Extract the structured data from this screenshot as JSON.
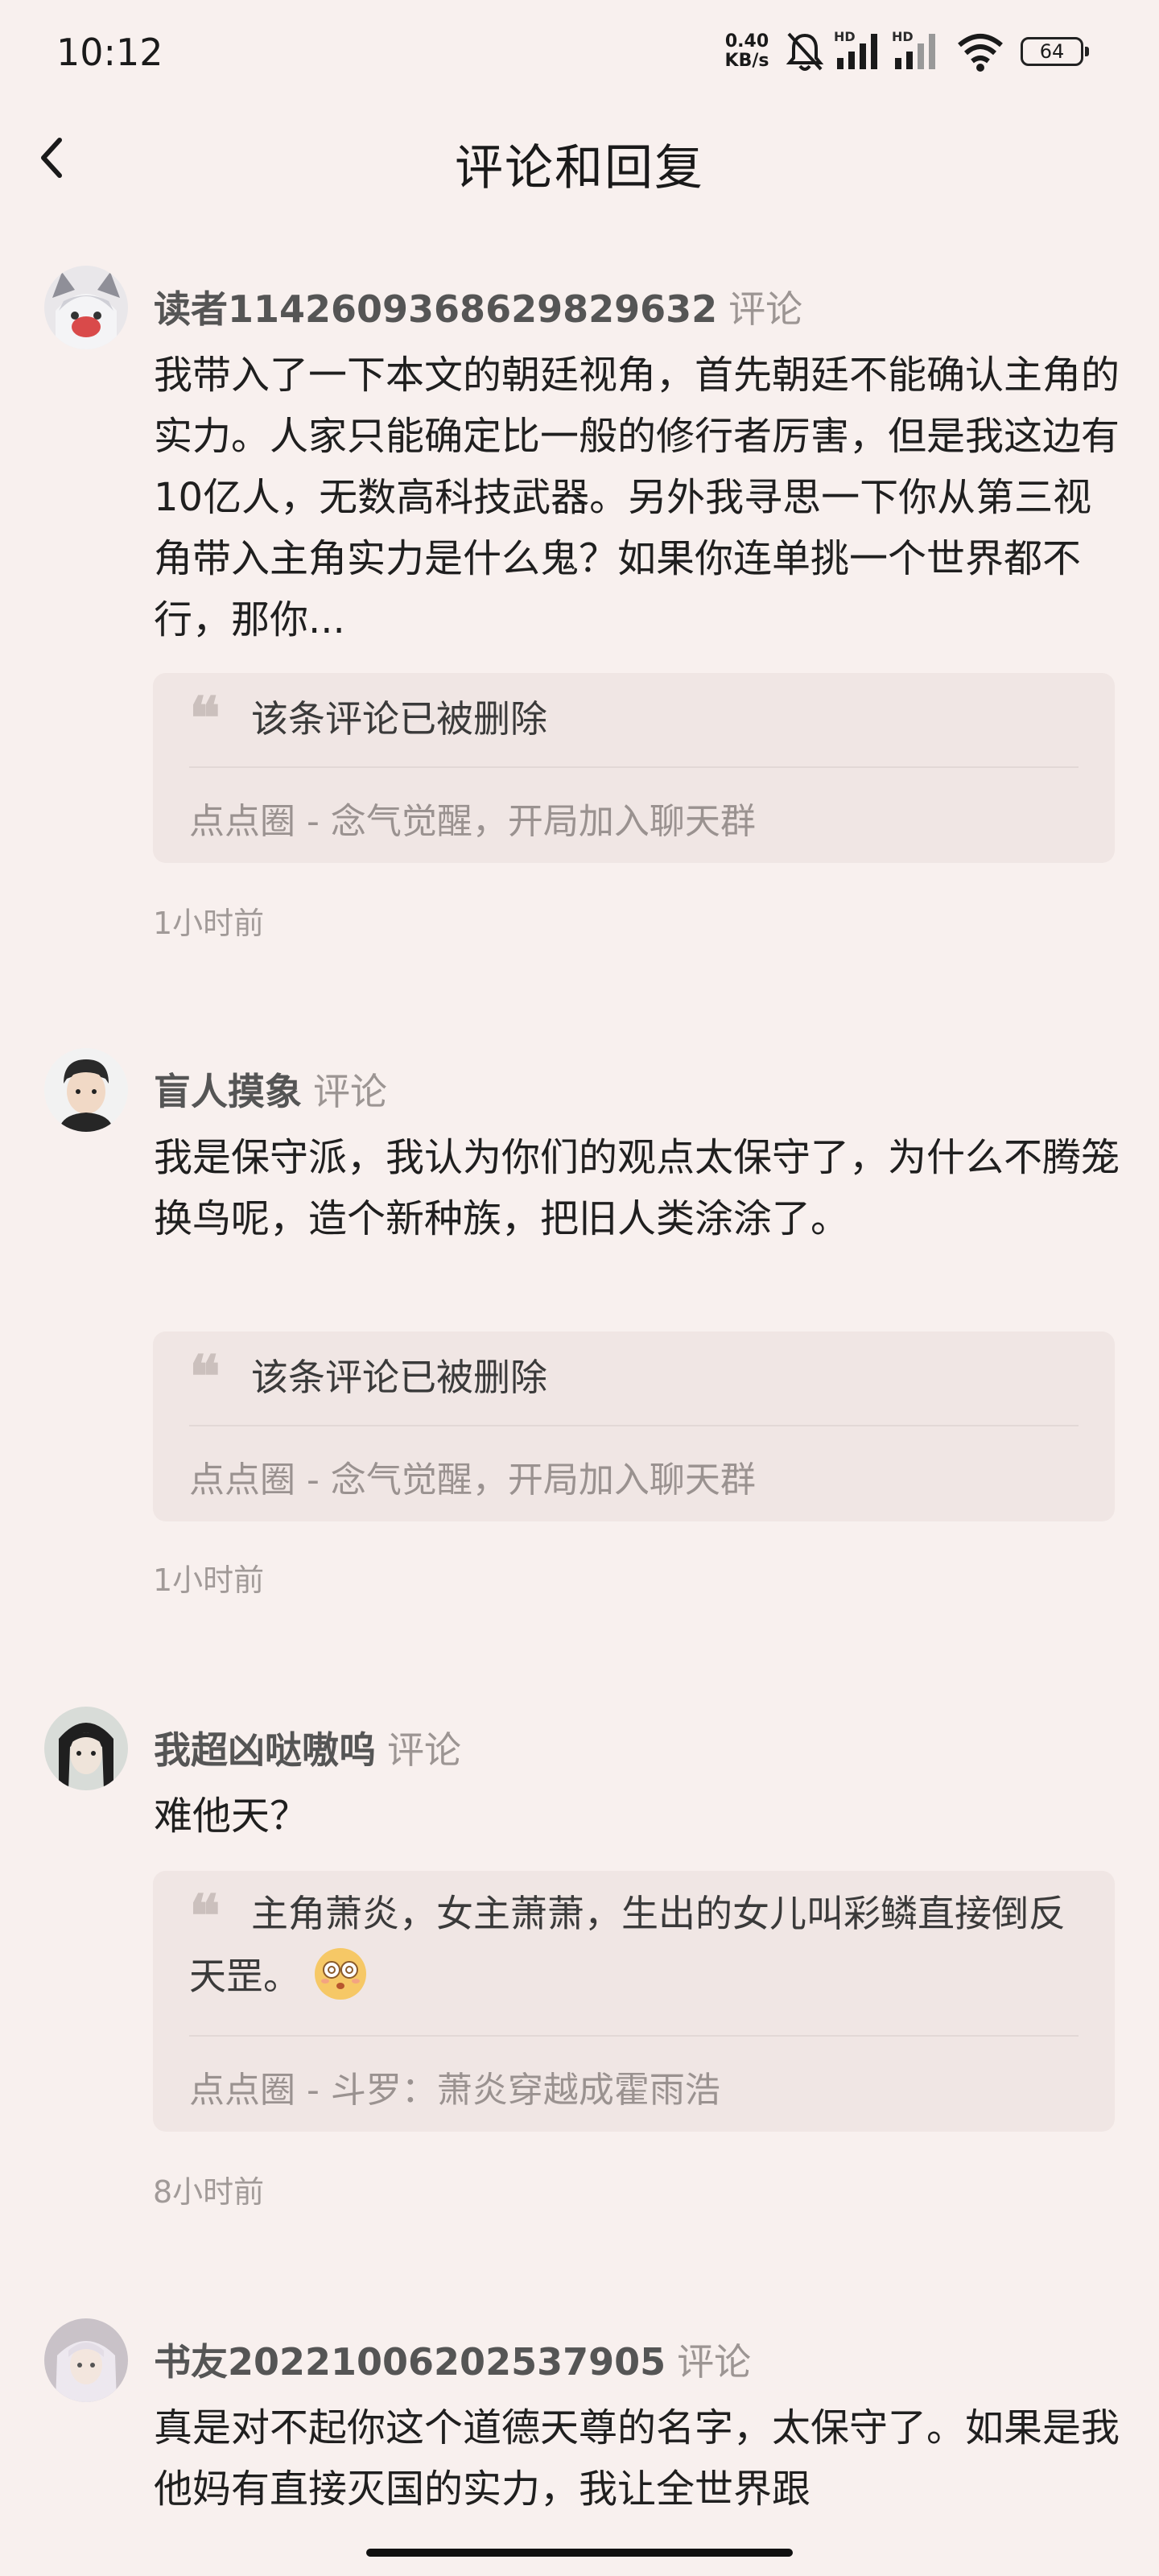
{
  "status_bar": {
    "time": "10:12",
    "net_speed_value": "0.40",
    "net_speed_unit": "KB/s",
    "signal1_label": "HD",
    "signal2_label": "HD",
    "battery": "64"
  },
  "header": {
    "title": "评论和回复"
  },
  "comments": [
    {
      "user": "读者1142609368629829632",
      "type": "评论",
      "text": "我带入了一下本文的朝廷视角，首先朝廷不能确认主角的实力。人家只能确定比一般的修行者厉害，但是我这边有10亿人，无数高科技武器。另外我寻思一下你从第三视角带入主角实力是什么鬼？如果你连单挑一个世界都不行，那你...",
      "quote": "该条评论已被删除",
      "source": "点点圈 - 念气觉醒，开局加入聊天群",
      "time": "1小时前"
    },
    {
      "user": "盲人摸象",
      "type": "评论",
      "text": "我是保守派，我认为你们的观点太保守了，为什么不腾笼换鸟呢，造个新种族，把旧人类涂涂了。",
      "quote": "该条评论已被删除",
      "source": "点点圈 - 念气觉醒，开局加入聊天群",
      "time": "1小时前"
    },
    {
      "user": "我超凶哒嗷呜",
      "type": "评论",
      "text": "难他天？",
      "quote": "主角萧炎，女主萧萧，生出的女儿叫彩鳞直接倒反天罡。",
      "source": "点点圈 - 斗罗：萧炎穿越成霍雨浩",
      "time": "8小时前"
    },
    {
      "user": "书友20221006202537905",
      "type": "评论",
      "text": "真是对不起你这个道德天尊的名字，太保守了。如果是我他妈有直接灭国的实力，我让全世界跟"
    }
  ]
}
